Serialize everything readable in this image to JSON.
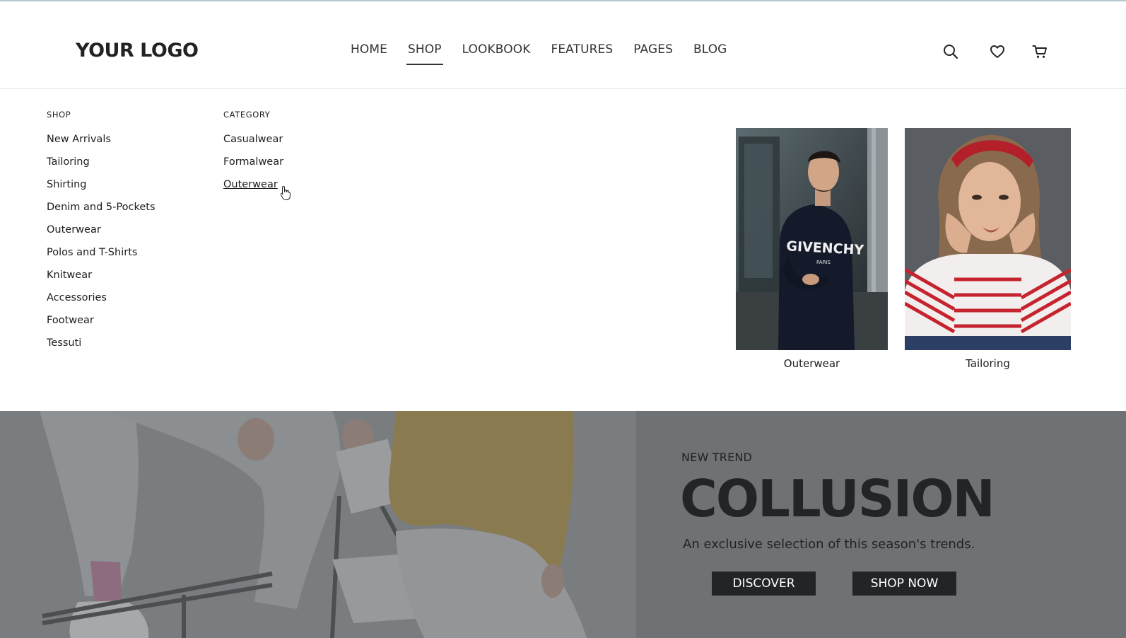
{
  "header": {
    "logo": "YOUR LOGO",
    "nav": [
      "HOME",
      "SHOP",
      "LOOKBOOK",
      "FEATURES",
      "PAGES",
      "BLOG"
    ],
    "active_nav": "SHOP",
    "icons": [
      "search-icon",
      "heart-icon",
      "cart-icon"
    ]
  },
  "mega_menu": {
    "shop": {
      "title": "SHOP",
      "items": [
        "New Arrivals",
        "Tailoring",
        "Shirting",
        "Denim and 5-Pockets",
        "Outerwear",
        "Polos and T-Shirts",
        "Knitwear",
        "Accessories",
        "Footwear",
        "Tessuti"
      ]
    },
    "category": {
      "title": "CATEGORY",
      "items": [
        "Casualwear",
        "Formalwear",
        "Outerwear"
      ],
      "hovered": "Outerwear"
    },
    "promos": [
      {
        "caption": "Outerwear",
        "shirt_text": "GIVENCHY",
        "shirt_subtext": "PARIS"
      },
      {
        "caption": "Tailoring"
      }
    ]
  },
  "hero": {
    "eyebrow": "NEW TREND",
    "title": "COLLUSION",
    "subtitle": "An exclusive selection of this season's trends.",
    "buttons": [
      "DISCOVER",
      "SHOP NOW"
    ]
  },
  "colors": {
    "text_dark": "#222426",
    "hero_overlay": "#6b6e70",
    "accent_yellow": "#d8b23a"
  }
}
